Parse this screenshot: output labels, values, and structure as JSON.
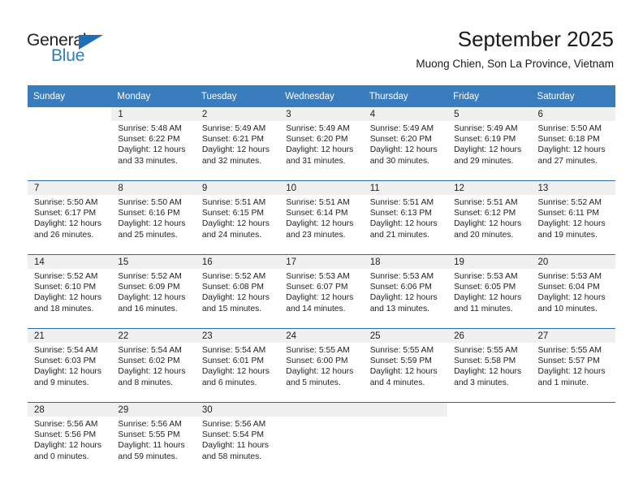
{
  "brand": {
    "name_top": "General",
    "name_bottom": "Blue",
    "triangle_color": "#1f6fb4",
    "text_color": "#231f20",
    "blue_color": "#2e7dc4"
  },
  "header": {
    "title": "September 2025",
    "subtitle": "Muong Chien, Son La Province, Vietnam"
  },
  "calendar": {
    "header_bg": "#3a7dbf",
    "header_text": "#ffffff",
    "daynum_bg": "#f0f0f0",
    "week_divider": "#2b6ca3",
    "weekdays": [
      "Sunday",
      "Monday",
      "Tuesday",
      "Wednesday",
      "Thursday",
      "Friday",
      "Saturday"
    ],
    "labels": {
      "sunrise": "Sunrise:",
      "sunset": "Sunset:",
      "daylight": "Daylight:"
    },
    "weeks": [
      [
        {
          "blank": true
        },
        {
          "day": "1",
          "sunrise": "Sunrise: 5:48 AM",
          "sunset": "Sunset: 6:22 PM",
          "daylight1": "Daylight: 12 hours",
          "daylight2": "and 33 minutes."
        },
        {
          "day": "2",
          "sunrise": "Sunrise: 5:49 AM",
          "sunset": "Sunset: 6:21 PM",
          "daylight1": "Daylight: 12 hours",
          "daylight2": "and 32 minutes."
        },
        {
          "day": "3",
          "sunrise": "Sunrise: 5:49 AM",
          "sunset": "Sunset: 6:20 PM",
          "daylight1": "Daylight: 12 hours",
          "daylight2": "and 31 minutes."
        },
        {
          "day": "4",
          "sunrise": "Sunrise: 5:49 AM",
          "sunset": "Sunset: 6:20 PM",
          "daylight1": "Daylight: 12 hours",
          "daylight2": "and 30 minutes."
        },
        {
          "day": "5",
          "sunrise": "Sunrise: 5:49 AM",
          "sunset": "Sunset: 6:19 PM",
          "daylight1": "Daylight: 12 hours",
          "daylight2": "and 29 minutes."
        },
        {
          "day": "6",
          "sunrise": "Sunrise: 5:50 AM",
          "sunset": "Sunset: 6:18 PM",
          "daylight1": "Daylight: 12 hours",
          "daylight2": "and 27 minutes."
        }
      ],
      [
        {
          "day": "7",
          "sunrise": "Sunrise: 5:50 AM",
          "sunset": "Sunset: 6:17 PM",
          "daylight1": "Daylight: 12 hours",
          "daylight2": "and 26 minutes."
        },
        {
          "day": "8",
          "sunrise": "Sunrise: 5:50 AM",
          "sunset": "Sunset: 6:16 PM",
          "daylight1": "Daylight: 12 hours",
          "daylight2": "and 25 minutes."
        },
        {
          "day": "9",
          "sunrise": "Sunrise: 5:51 AM",
          "sunset": "Sunset: 6:15 PM",
          "daylight1": "Daylight: 12 hours",
          "daylight2": "and 24 minutes."
        },
        {
          "day": "10",
          "sunrise": "Sunrise: 5:51 AM",
          "sunset": "Sunset: 6:14 PM",
          "daylight1": "Daylight: 12 hours",
          "daylight2": "and 23 minutes."
        },
        {
          "day": "11",
          "sunrise": "Sunrise: 5:51 AM",
          "sunset": "Sunset: 6:13 PM",
          "daylight1": "Daylight: 12 hours",
          "daylight2": "and 21 minutes."
        },
        {
          "day": "12",
          "sunrise": "Sunrise: 5:51 AM",
          "sunset": "Sunset: 6:12 PM",
          "daylight1": "Daylight: 12 hours",
          "daylight2": "and 20 minutes."
        },
        {
          "day": "13",
          "sunrise": "Sunrise: 5:52 AM",
          "sunset": "Sunset: 6:11 PM",
          "daylight1": "Daylight: 12 hours",
          "daylight2": "and 19 minutes."
        }
      ],
      [
        {
          "day": "14",
          "sunrise": "Sunrise: 5:52 AM",
          "sunset": "Sunset: 6:10 PM",
          "daylight1": "Daylight: 12 hours",
          "daylight2": "and 18 minutes."
        },
        {
          "day": "15",
          "sunrise": "Sunrise: 5:52 AM",
          "sunset": "Sunset: 6:09 PM",
          "daylight1": "Daylight: 12 hours",
          "daylight2": "and 16 minutes."
        },
        {
          "day": "16",
          "sunrise": "Sunrise: 5:52 AM",
          "sunset": "Sunset: 6:08 PM",
          "daylight1": "Daylight: 12 hours",
          "daylight2": "and 15 minutes."
        },
        {
          "day": "17",
          "sunrise": "Sunrise: 5:53 AM",
          "sunset": "Sunset: 6:07 PM",
          "daylight1": "Daylight: 12 hours",
          "daylight2": "and 14 minutes."
        },
        {
          "day": "18",
          "sunrise": "Sunrise: 5:53 AM",
          "sunset": "Sunset: 6:06 PM",
          "daylight1": "Daylight: 12 hours",
          "daylight2": "and 13 minutes."
        },
        {
          "day": "19",
          "sunrise": "Sunrise: 5:53 AM",
          "sunset": "Sunset: 6:05 PM",
          "daylight1": "Daylight: 12 hours",
          "daylight2": "and 11 minutes."
        },
        {
          "day": "20",
          "sunrise": "Sunrise: 5:53 AM",
          "sunset": "Sunset: 6:04 PM",
          "daylight1": "Daylight: 12 hours",
          "daylight2": "and 10 minutes."
        }
      ],
      [
        {
          "day": "21",
          "sunrise": "Sunrise: 5:54 AM",
          "sunset": "Sunset: 6:03 PM",
          "daylight1": "Daylight: 12 hours",
          "daylight2": "and 9 minutes."
        },
        {
          "day": "22",
          "sunrise": "Sunrise: 5:54 AM",
          "sunset": "Sunset: 6:02 PM",
          "daylight1": "Daylight: 12 hours",
          "daylight2": "and 8 minutes."
        },
        {
          "day": "23",
          "sunrise": "Sunrise: 5:54 AM",
          "sunset": "Sunset: 6:01 PM",
          "daylight1": "Daylight: 12 hours",
          "daylight2": "and 6 minutes."
        },
        {
          "day": "24",
          "sunrise": "Sunrise: 5:55 AM",
          "sunset": "Sunset: 6:00 PM",
          "daylight1": "Daylight: 12 hours",
          "daylight2": "and 5 minutes."
        },
        {
          "day": "25",
          "sunrise": "Sunrise: 5:55 AM",
          "sunset": "Sunset: 5:59 PM",
          "daylight1": "Daylight: 12 hours",
          "daylight2": "and 4 minutes."
        },
        {
          "day": "26",
          "sunrise": "Sunrise: 5:55 AM",
          "sunset": "Sunset: 5:58 PM",
          "daylight1": "Daylight: 12 hours",
          "daylight2": "and 3 minutes."
        },
        {
          "day": "27",
          "sunrise": "Sunrise: 5:55 AM",
          "sunset": "Sunset: 5:57 PM",
          "daylight1": "Daylight: 12 hours",
          "daylight2": "and 1 minute."
        }
      ],
      [
        {
          "day": "28",
          "sunrise": "Sunrise: 5:56 AM",
          "sunset": "Sunset: 5:56 PM",
          "daylight1": "Daylight: 12 hours",
          "daylight2": "and 0 minutes."
        },
        {
          "day": "29",
          "sunrise": "Sunrise: 5:56 AM",
          "sunset": "Sunset: 5:55 PM",
          "daylight1": "Daylight: 11 hours",
          "daylight2": "and 59 minutes."
        },
        {
          "day": "30",
          "sunrise": "Sunrise: 5:56 AM",
          "sunset": "Sunset: 5:54 PM",
          "daylight1": "Daylight: 11 hours",
          "daylight2": "and 58 minutes."
        },
        {
          "empty": true
        },
        {
          "empty": true
        },
        {
          "blank": true
        },
        {
          "blank": true
        }
      ]
    ]
  }
}
